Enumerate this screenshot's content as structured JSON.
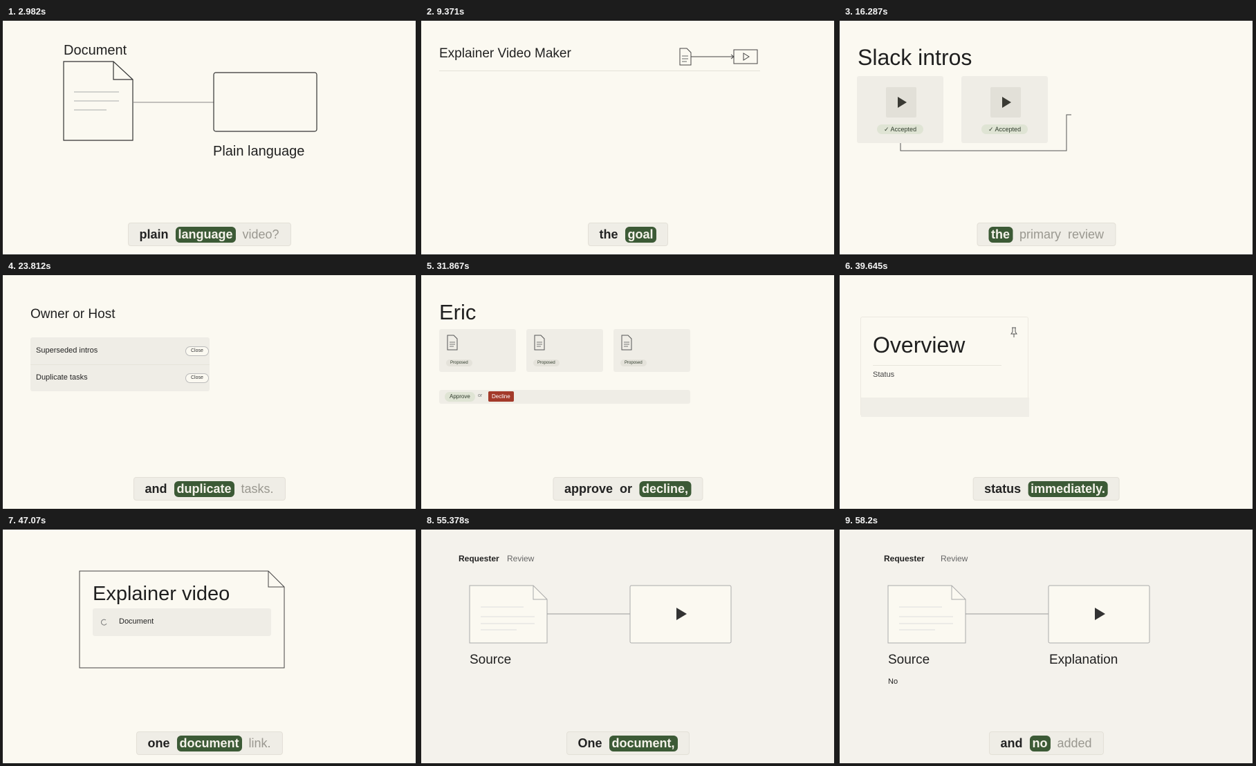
{
  "frames": [
    {
      "timestamp": "1. 2.982s",
      "doc_label": "Document",
      "output_label": "Plain language",
      "caption": [
        {
          "text": "plain",
          "style": "normal"
        },
        {
          "text": "language",
          "style": "highlight"
        },
        {
          "text": "video?",
          "style": "dim"
        }
      ]
    },
    {
      "timestamp": "2. 9.371s",
      "title": "Explainer Video Maker",
      "caption": [
        {
          "text": "the",
          "style": "normal"
        },
        {
          "text": "goal",
          "style": "highlight"
        }
      ]
    },
    {
      "timestamp": "3. 16.287s",
      "title": "Slack intros",
      "badge1": "✓ Accepted",
      "badge2": "✓ Accepted",
      "caption": [
        {
          "text": "the",
          "style": "highlight"
        },
        {
          "text": "primary",
          "style": "dim"
        },
        {
          "text": "review",
          "style": "dim"
        }
      ]
    },
    {
      "timestamp": "4. 23.812s",
      "title": "Owner or Host",
      "row1": "Superseded intros",
      "row2": "Duplicate tasks",
      "close_label": "Close",
      "caption": [
        {
          "text": "and",
          "style": "normal"
        },
        {
          "text": "duplicate",
          "style": "highlight"
        },
        {
          "text": "tasks.",
          "style": "dim"
        }
      ]
    },
    {
      "timestamp": "5. 31.867s",
      "title": "Eric",
      "proposed": "Proposed",
      "approve": "Approve",
      "or": "or",
      "decline": "Decline",
      "caption": [
        {
          "text": "approve",
          "style": "normal"
        },
        {
          "text": "or",
          "style": "normal"
        },
        {
          "text": "decline,",
          "style": "highlight"
        }
      ]
    },
    {
      "timestamp": "6. 39.645s",
      "title": "Overview",
      "status": "Status",
      "caption": [
        {
          "text": "status",
          "style": "normal"
        },
        {
          "text": "immediately.",
          "style": "highlight"
        }
      ]
    },
    {
      "timestamp": "7. 47.07s",
      "title": "Explainer video",
      "field": "Document",
      "caption": [
        {
          "text": "one",
          "style": "normal"
        },
        {
          "text": "document",
          "style": "highlight"
        },
        {
          "text": "link.",
          "style": "dim"
        }
      ]
    },
    {
      "timestamp": "8. 55.378s",
      "tab1": "Requester",
      "tab2": "Review",
      "source": "Source",
      "caption": [
        {
          "text": "One",
          "style": "normal"
        },
        {
          "text": "document,",
          "style": "highlight"
        }
      ]
    },
    {
      "timestamp": "9. 58.2s",
      "tab1": "Requester",
      "tab2": "Review",
      "source": "Source",
      "explanation": "Explanation",
      "note": "No",
      "caption": [
        {
          "text": "and",
          "style": "normal"
        },
        {
          "text": "no",
          "style": "highlight"
        },
        {
          "text": "added",
          "style": "dim"
        }
      ]
    }
  ],
  "colors": {
    "accent": "#3c5a36",
    "decline": "#a33a2a",
    "background": "#fbf9f1",
    "header": "#1c1c1c"
  }
}
